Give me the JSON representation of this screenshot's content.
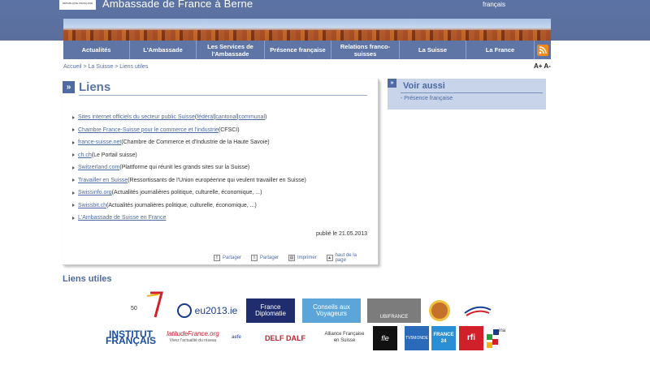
{
  "header": {
    "logo_text": "RÉPUBLIQUE FRANÇAISE",
    "title": "Ambassade de France à Berne",
    "language": "français"
  },
  "nav": {
    "items": [
      {
        "label": "Actualités"
      },
      {
        "label": "L'Ambassade"
      },
      {
        "label": "Les Services de l'Ambassade"
      },
      {
        "label": "Présence française"
      },
      {
        "label": "Relations franco-suisses"
      },
      {
        "label": "La Suisse"
      },
      {
        "label": "La France"
      }
    ],
    "rss_icon": "rss-icon"
  },
  "breadcrumb": "Accueil > La Suisse > Liens utiles",
  "font_controls": "A+ A-",
  "main": {
    "title": "Liens",
    "links": [
      {
        "link": "Sites internet officiels du secteur public Suisse",
        "pre": " (",
        "sub1": "fédéral",
        "sep1": " | ",
        "sub2": "cantonal",
        "sep2": " | ",
        "sub3": "communal",
        "post": ")"
      },
      {
        "link": "Chambre France-Suisse pour le commerce et l'industrie",
        "post": " (CFSCI)"
      },
      {
        "link": "france-suisse.net",
        "post": " (Chambre de Commerce et d'Industrie de la Haute Savoie)"
      },
      {
        "link": "ch.ch",
        "post": " (Le Portail suisse)"
      },
      {
        "link": "Switzerland.com",
        "post": " (Plattforme qui réunit les grands sites sur la Suisse)"
      },
      {
        "link": "Travailler en Suisse",
        "post": " (Ressortissants de l'Union européenne qui veulent travailler en Suisse)"
      },
      {
        "link": "Swissinfo.org",
        "post": " (Actualités journalières politique, culturelle, économique, ...)"
      },
      {
        "link": "Swissbit.ch",
        "post": " (Actualités journalières politique, culturelle, économique, ...)"
      },
      {
        "link": "L'Ambassade de Suisse en France",
        "post": ""
      }
    ],
    "published": "publié le 21.05.2013",
    "actions": {
      "share1": "Partager",
      "share2": "Partager",
      "print": "Imprimer",
      "top": "haut de la page"
    }
  },
  "sidebar": {
    "title": "Voir aussi",
    "item": "- Présence française"
  },
  "useful": {
    "title": "Liens utiles",
    "logos": {
      "anniv": "50",
      "eu2013": "eu2013.ie",
      "fd": "France Diplomatie",
      "cv": "Conseils aux Voyageurs",
      "ubi": "UBIFRANCE",
      "institut": "INSTITUT FRANÇAIS",
      "latitude": "latitudeFrance.org",
      "latitude_sub": "Vivez l'actualité du réseau",
      "aefe": "aefe",
      "delf": "DELF DALF",
      "af": "Alliance Française en Suisse",
      "fle": "fle",
      "tv5": "TV5MONDE",
      "f24": "FRANCE 24",
      "rfi": "rfi",
      "ina": "ina"
    }
  },
  "colors": {
    "header_blue": "#5b73a4",
    "link_blue": "#4d6aa0",
    "sidebar_bg": "#c8d4ea",
    "rss_orange": "#f08a1f"
  }
}
